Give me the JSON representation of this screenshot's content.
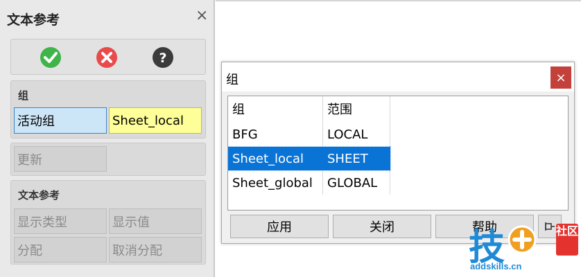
{
  "panel": {
    "title": "文本参考",
    "close_glyph": "×",
    "toolbar": {
      "ok_icon": "check-icon",
      "cancel_icon": "cancel-icon",
      "help_icon": "help-icon",
      "colors": {
        "ok": "#3fb449",
        "cancel": "#e94b4b",
        "help": "#3b3b3b"
      }
    },
    "group_section": {
      "title": "组",
      "active_group_label": "活动组",
      "active_group_value": "Sheet_local"
    },
    "update_button": "更新",
    "text_ref_section": {
      "title": "文本参考",
      "show_type": "显示类型",
      "show_value": "显示值",
      "assign": "分配",
      "unassign": "取消分配"
    }
  },
  "dialog": {
    "title": "组",
    "close_glyph": "×",
    "columns": [
      "组",
      "范围"
    ],
    "rows": [
      {
        "group": "BFG",
        "scope": "LOCAL",
        "selected": false
      },
      {
        "group": "Sheet_local",
        "scope": "SHEET",
        "selected": true
      },
      {
        "group": "Sheet_global",
        "scope": "GLOBAL",
        "selected": false
      }
    ],
    "buttons": {
      "apply": "应用",
      "close": "关闭",
      "help": "帮助"
    },
    "pin_icon": "pin-icon",
    "selection_color": "#0a74d6"
  },
  "watermark": {
    "logo_text": "技",
    "badge_text": "社区",
    "url": "addskills.cn"
  }
}
